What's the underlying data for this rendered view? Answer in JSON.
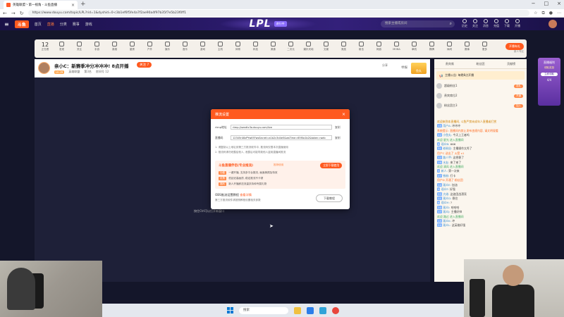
{
  "browser": {
    "tab_title": "英雄联盟丶第一视角 - 斗鱼直播",
    "url": "https://www.douyu.com/topic/LPL?rid=1&dyshid=0-c3b1ef6f5fe4a7f2ae90a4f97b35f7e5b23f0ff1"
  },
  "site": {
    "logo": "斗鱼",
    "nav": [
      "首页",
      "直播",
      "分类",
      "赛事",
      "游戏"
    ],
    "banner_text": "LPL",
    "banner_badge": "进行中",
    "search_placeholder": "搜索主播或房间",
    "tools": [
      "历史",
      "关注",
      "消息",
      "充值",
      "下载",
      "开播"
    ]
  },
  "categories": {
    "room_num": "12",
    "room_label": "正在看",
    "items": [
      "发现",
      "关注",
      "手游",
      "英雄",
      "星秀",
      "户外",
      "娱乐",
      "音乐",
      "游戏",
      "主机",
      "体育",
      "科技",
      "美食",
      "二次元",
      "娱乐天地",
      "文娱",
      "竞技",
      "射击",
      "网游",
      "MOBA",
      "单机",
      "棋牌",
      "休闲",
      "赛事",
      "更多"
    ],
    "cta": "开播有礼",
    "cta_sub": "新人专区"
  },
  "stream": {
    "title": "亲小C：新赛季冲分冲冲冲! 8点开播",
    "level": "LV.28",
    "category": "英雄联盟",
    "rank": "第3名",
    "room": "房间号 12",
    "follow": "关注 7",
    "share": "分享",
    "report": "举报",
    "gold": "鱼丸"
  },
  "video": {
    "hint": "按住Ctrl可以打开新窗口"
  },
  "modal": {
    "title": "推流设置",
    "server_label": "rtmp地址",
    "server_value": "rtmp://sendtc3a.douyu.com/live",
    "server_btn": "复制",
    "key_label": "直播码",
    "key_value": "12345rU8zPYwK9?wsSecret=a1b2c3d4e5&wsTime=65f0a1b2&token=web",
    "key_btn": "复制",
    "note1": "1. 请复制以上地址到第三方推流软件中, 推流码仅限本次直播使用",
    "note2": "2. 推流码请勿泄露给他人, 泄露后可能导致他人盗用直播间推流",
    "pro_title": "斗鱼直播伴侣(专业推流)",
    "pro_tag": "推荐使用",
    "pro_btn": "立即下载使用",
    "pro_lines": [
      {
        "tag": "功能",
        "text": "一键开播, 支持多平台推流, 画面美颜及特效"
      },
      {
        "tag": "优势",
        "text": "低延迟高画质, 稳定推流不卡顿"
      },
      {
        "tag": "福利",
        "text": "新人开播即送流量扶持和专属礼物"
      }
    ],
    "bottom_title": "OBS推流设置教程",
    "bottom_link": "查看详情",
    "bottom_sub": "第三方推流软件请按照教程设置相关参数",
    "download_btn": "下载教程"
  },
  "rpanel": {
    "tabs": [
      "贵宾席",
      "粉丝团",
      "贡献榜"
    ],
    "notice": "主播公告: 每晚8点开播",
    "rows": [
      {
        "name": "超级粉丝1",
        "pill": "送礼"
      },
      {
        "name": "贵宾席位2",
        "pill": "开通"
      },
      {
        "name": "粉丝团主3",
        "pill": "加入"
      }
    ],
    "chat": [
      {
        "type": "sys",
        "text": "欢迎来到本直播间, 斗鱼严禁未成年人直播或打赏"
      },
      {
        "type": "normal",
        "lv": "15",
        "name": "用户A:",
        "text": "冲冲冲"
      },
      {
        "type": "hl",
        "text": "系统提示: 直播间内禁止发布违规内容, 请文明观看"
      },
      {
        "type": "normal",
        "lv": "22",
        "name": "小鱼丸:",
        "text": "今天上王者吗"
      },
      {
        "type": "grn",
        "text": "欢迎 星光 进入直播间"
      },
      {
        "type": "normal",
        "lv": "8",
        "name": "观众B:",
        "text": "666"
      },
      {
        "type": "normal",
        "lv": "31",
        "name": "老粉丝:",
        "text": "主播操作太秀了"
      },
      {
        "type": "hl",
        "text": "用户C 送出了 火箭 x1"
      },
      {
        "type": "normal",
        "lv": "12",
        "name": "路人甲:",
        "text": "这把稳了"
      },
      {
        "type": "normal",
        "lv": "19",
        "name": "水友:",
        "text": "来了来了"
      },
      {
        "type": "grn",
        "text": "欢迎 清风 进入直播间"
      },
      {
        "type": "normal",
        "lv": "5",
        "name": "新人:",
        "text": "第一次来"
      },
      {
        "type": "normal",
        "lv": "27",
        "name": "铁粉:",
        "text": "打卡"
      },
      {
        "type": "hl",
        "text": "用户D 开通了 粉丝团"
      },
      {
        "type": "normal",
        "lv": "14",
        "name": "观众E:",
        "text": "加油"
      },
      {
        "type": "normal",
        "lv": "9",
        "name": "观众F:",
        "text": "好强"
      },
      {
        "type": "normal",
        "lv": "33",
        "name": "大佬:",
        "text": "这波团战漂亮"
      },
      {
        "type": "normal",
        "lv": "11",
        "name": "观众G:",
        "text": "稳住"
      },
      {
        "type": "normal",
        "lv": "6",
        "name": "观众H:",
        "text": "?"
      },
      {
        "type": "normal",
        "lv": "20",
        "name": "观众I:",
        "text": "哈哈哈"
      },
      {
        "type": "normal",
        "lv": "17",
        "name": "观众J:",
        "text": "主播好帅"
      },
      {
        "type": "grn",
        "text": "欢迎 路过 进入直播间"
      },
      {
        "type": "normal",
        "lv": "13",
        "name": "观众K:",
        "text": "冲"
      },
      {
        "type": "normal",
        "lv": "24",
        "name": "观众L:",
        "text": "这英雄好强"
      }
    ]
  },
  "side_float": {
    "t1": "直播福利",
    "t2": "领取奖励",
    "btn": "立即领取",
    "num": "4/4"
  },
  "taskbar": {
    "search": "搜索"
  },
  "colors": {
    "accent": "#ff5a1f",
    "header": "#2a1a6a"
  }
}
